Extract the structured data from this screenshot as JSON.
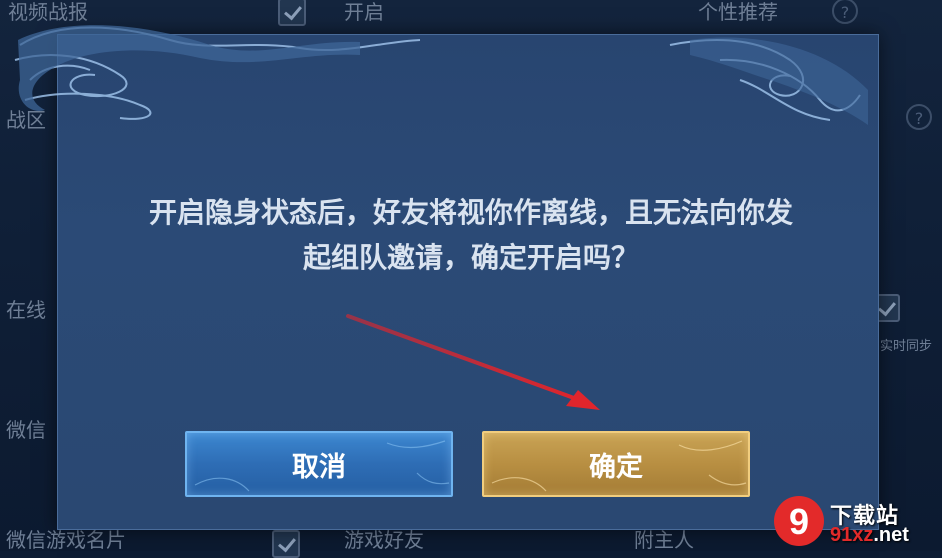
{
  "background": {
    "row1_label": "视频战报",
    "row1_value": "开启",
    "row1_right": "个性推荐",
    "row2_label": "战区",
    "row3_label": "在线",
    "row4_label": "微信",
    "row5_label": "微信游戏名片",
    "row5_value": "游戏好友",
    "row5_right": "附主人",
    "right_partial": "实时同步"
  },
  "dialog": {
    "message_line1": "开启隐身状态后，好友将视你作离线，且无法向你发",
    "message_line2": "起组队邀请，确定开启吗？",
    "cancel_label": "取消",
    "confirm_label": "确定"
  },
  "watermark": {
    "logo_text": "9",
    "site_name": "下载站",
    "domain_prefix": "91xz",
    "domain_suffix": ".net"
  },
  "colors": {
    "dialog_bg": "#2b4a76",
    "cancel_button": "#2e6db5",
    "confirm_button": "#b88f42",
    "arrow": "#e0252c"
  }
}
